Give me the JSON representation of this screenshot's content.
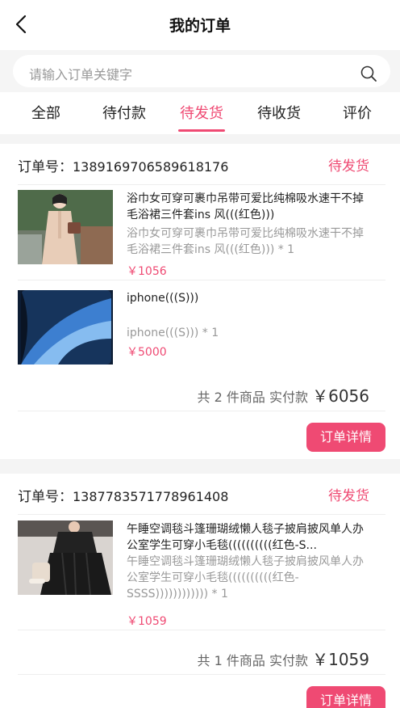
{
  "header": {
    "title": "我的订单"
  },
  "search": {
    "placeholder": "请输入订单关键字"
  },
  "tabs": [
    {
      "label": "全部"
    },
    {
      "label": "待付款"
    },
    {
      "label": "待发货"
    },
    {
      "label": "待收货"
    },
    {
      "label": "评价"
    }
  ],
  "active_tab": "待发货",
  "orders": [
    {
      "label": "订单号：",
      "number": "1389169706589618176",
      "status": "待发货",
      "items": [
        {
          "name": "浴巾女可穿可裹巾吊带可爱比纯棉吸水速干不掉毛浴裙三件套ins 风(((红色)))",
          "spec": "浴巾女可穿可裹巾吊带可爱比纯棉吸水速干不掉毛浴裙三件套ins 风(((红色))) * 1",
          "price": "￥1056"
        },
        {
          "name": "iphone(((S)))",
          "spec": "iphone(((S))) * 1",
          "price": "￥5000"
        }
      ],
      "summary_text": "共 2 件商品 实付款",
      "total": "￥6056",
      "detail_button": "订单详情"
    },
    {
      "label": "订单号：",
      "number": "1387783571778961408",
      "status": "待发货",
      "items": [
        {
          "name": "午睡空调毯斗篷珊瑚绒懒人毯子披肩披风单人办公室学生可穿小毛毯((((((((((红色-S...",
          "spec": "午睡空调毯斗篷珊瑚绒懒人毯子披肩披风单人办公室学生可穿小毛毯((((((((((红色-SSSS)))))))))))) * 1",
          "price": "￥1059"
        }
      ],
      "summary_text": "共 1 件商品 实付款",
      "total": "￥1059",
      "detail_button": "订单详情"
    }
  ],
  "colors": {
    "accent": "#ef4a73",
    "background": "#f4f4f4"
  },
  "icons": [
    "back-arrow-icon",
    "search-icon"
  ]
}
